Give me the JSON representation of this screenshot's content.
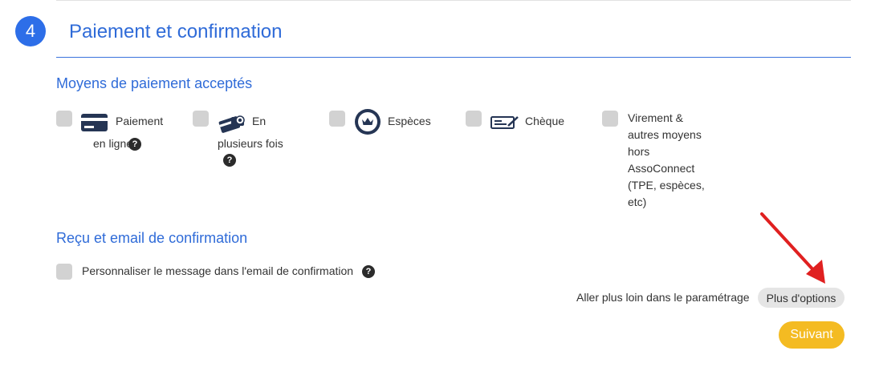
{
  "step": {
    "number": "4",
    "title": "Paiement et confirmation"
  },
  "payment_methods": {
    "heading": "Moyens de paiement acceptés",
    "options": [
      {
        "line1": "Paiement",
        "line2": "en ligne",
        "icon": "credit-card-icon",
        "help": "?"
      },
      {
        "line1": "En",
        "line2": "plusieurs fois",
        "icon": "cards-payment-icon",
        "help": "?"
      },
      {
        "line1": "Espèces",
        "icon": "cash-crown-icon"
      },
      {
        "line1": "Chèque",
        "icon": "cheque-icon"
      },
      {
        "lines": [
          "Virement &",
          "autres moyens",
          "hors",
          "AssoConnect",
          "(TPE, espèces,",
          "etc)"
        ]
      }
    ]
  },
  "confirmation": {
    "heading": "Reçu et email de confirmation",
    "customize_label": "Personnaliser le message dans l'email de confirmation",
    "help": "?"
  },
  "footer": {
    "more_text": "Aller plus loin dans le paramétrage",
    "more_button": "Plus d'options",
    "next_button": "Suivant"
  },
  "colors": {
    "accent": "#2f6bd8",
    "next": "#f4bb22",
    "arrow": "#e02020",
    "icon_dark": "#253554"
  }
}
